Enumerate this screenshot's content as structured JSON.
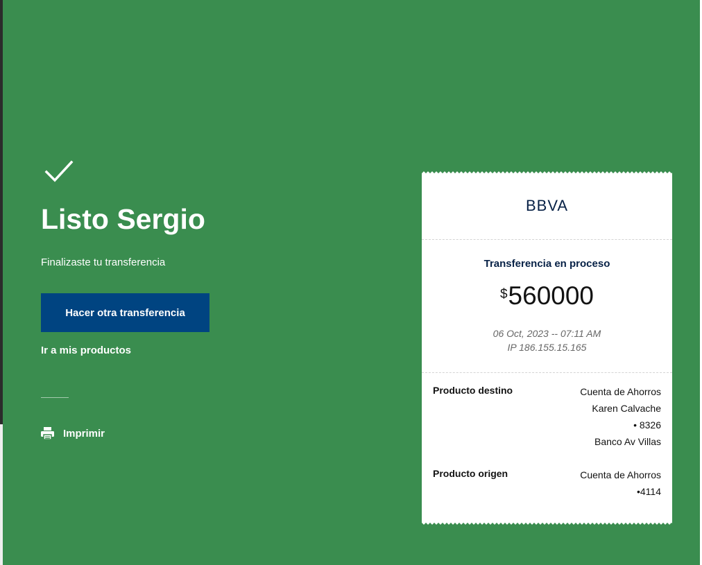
{
  "hero": {
    "title": "Listo Sergio",
    "subtitle": "Finalizaste tu transferencia",
    "primary_button": "Hacer otra transferencia",
    "products_link": "Ir a mis productos",
    "print_label": "Imprimir"
  },
  "receipt": {
    "bank": "BBVA",
    "status": "Transferencia en proceso",
    "currency_symbol": "$",
    "amount": "560000",
    "datetime": "06 Oct, 2023 -- 07:11 AM",
    "ip": "IP 186.155.15.165",
    "destination": {
      "label": "Producto destino",
      "lines": [
        "Cuenta de Ahorros",
        "Karen Calvache",
        "• 8326",
        "Banco Av Villas"
      ]
    },
    "origin": {
      "label": "Producto origen",
      "lines": [
        "Cuenta de Ahorros",
        "•4114"
      ]
    }
  },
  "colors": {
    "background": "#3a8d4f",
    "primary_button": "#004481",
    "bank_navy": "#072146"
  },
  "icons": {
    "success": "check-icon",
    "print": "printer-icon"
  }
}
